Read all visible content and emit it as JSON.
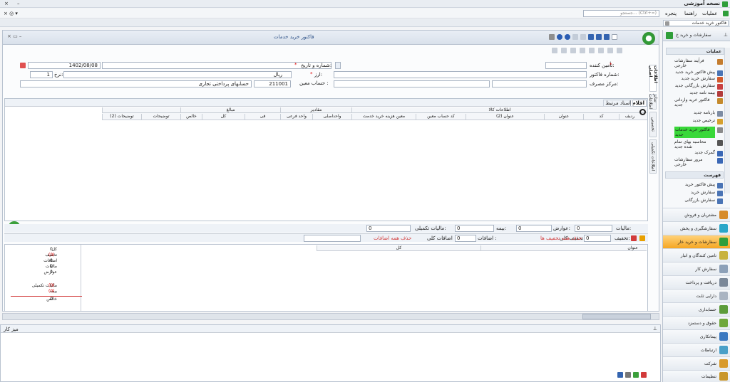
{
  "app": {
    "title": "نسخه آموزشی",
    "minimize": "–",
    "close": "×",
    "pin_glyph": "× ◎ ▾"
  },
  "menu": {
    "items": [
      "عملیات",
      "راهنما",
      "پنجره"
    ],
    "search_placeholder": "جستجو... (Ctrl+=)"
  },
  "doc_tab": {
    "label": "فاکتور خرید خدمات",
    "close": "×"
  },
  "form": {
    "title": "فاکتور خرید خدمات",
    "labels": {
      "supplier": "تأمین کننده:",
      "invoice_no": "شماره فاکتور:",
      "cost_center": "مرکز مصرف:",
      "number_date": "شماره و تاریخ:",
      "currency": "ارز:",
      "account": "حساب معین :",
      "rate": "نرخ:"
    },
    "values": {
      "date": "1402/08/08",
      "currency": "ریال",
      "rate": "1",
      "account_code": "211001",
      "account_name": "حسابهای پرداختی تجاری"
    },
    "side_tabs": [
      "اطلاعات اصلی",
      "سایر اطلاعات",
      "تخصیص",
      "اطلاعات تکمیلی"
    ]
  },
  "grid": {
    "tabs": [
      "اقلام",
      "اسناد مرتبط"
    ],
    "group_headers": {
      "goods": "اطلاعات کالا",
      "quantity": "مقادیر",
      "amount": "مبالغ"
    },
    "columns": [
      "ردیف",
      "کد",
      "عنوان",
      "عنوان (2)",
      "کد حساب معین",
      "معین هزینه خرید خدمت",
      "واحداصلی",
      "واحد فرعی",
      "فی",
      "کل",
      "خالص",
      "توضیحات",
      "توضیحات (2)"
    ]
  },
  "totals_bar": {
    "vat": "مالیات:",
    "vat_value": "0",
    "tolls": "عوارض:",
    "tolls_value": "0",
    "insurance": "بیمه:",
    "insurance_value": "0",
    "extra_vat": "مالیات تکمیلی:",
    "extra_vat_value": "0"
  },
  "discount_bar": {
    "discount": "تخفیف:",
    "discount_value": "0",
    "total_discount": "تخفیف کلی",
    "remove_all_discounts": "حذف همه تخفیف ها",
    "extras": "اضافات :",
    "extras_value": "0",
    "total_extras": "اضافات کلی",
    "remove_all_extras": "حذف همه اضافات"
  },
  "lower_grid": {
    "columns": [
      "عنوان",
      "کل"
    ]
  },
  "summary": {
    "rows": [
      {
        "label": "کل",
        "value": "0"
      },
      {
        "label": "تخفیف",
        "value": "(0)"
      },
      {
        "label": "اضافات",
        "value": "0"
      },
      {
        "label": "مالیات",
        "value": "0"
      },
      {
        "label": "عوارض",
        "value": "0"
      },
      {
        "label": "مالیات تکمیلی",
        "value": "(0)"
      },
      {
        "label": "بیمه",
        "value": "(0)"
      },
      {
        "label": "خالص",
        "value": "0"
      }
    ]
  },
  "worktray": {
    "title": "میز کار"
  },
  "right_panel": {
    "header": "سفارشات و خرید خ",
    "operations_title": "عملیات",
    "operations": [
      "فرآیند سفارشات خارجی",
      "پیش فاکتور خرید جدید",
      "سفارش خرید جدید",
      "سفارش بازرگانی جدید",
      "بیمه نامه جدید",
      "فاکتور خرید وارداتی جدید",
      "بارنامه جدید",
      "ترخیص جدید",
      "فاکتور خرید خدمات جدید",
      "محاسبه بهای تمام شده جدید",
      "گمرک جدید",
      "مرور سفارشات خارجی"
    ],
    "list_title": "فهرست",
    "list": [
      "پیش فاکتور خرید",
      "سفارش خرید",
      "سفارش بازرگانی"
    ],
    "nav": [
      "مشتریان و فروش",
      "سفارشگیری و پخش",
      "سفارشات و خرید خار",
      "تامین کنندگان و انبار",
      "سفارش کار",
      "دریافت و پرداخت",
      "دارایی ثابت",
      "حسابداری",
      "حقوق و دستمزد",
      "پیمانکاری",
      "ارتباطات",
      "شرکت",
      "تنظیمات"
    ],
    "nav_active": "سفارشات و خرید خار"
  },
  "colors": {
    "accent": "#f39c12",
    "title_blue": "#2b4f86",
    "highlight": "#39d839"
  }
}
